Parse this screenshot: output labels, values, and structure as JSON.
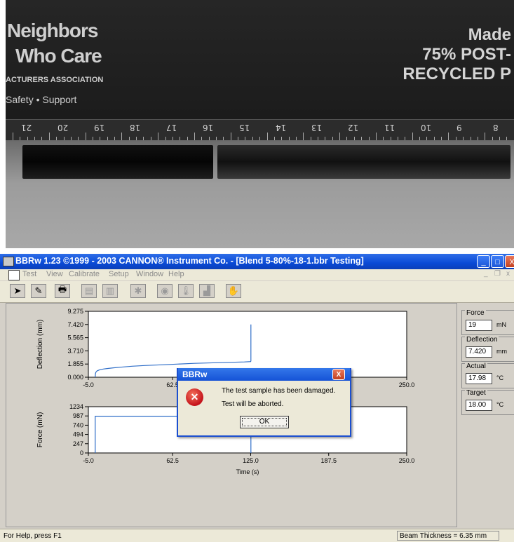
{
  "photo": {
    "brand_line1": "Neighbors",
    "brand_line2": "Who Care",
    "brand_line3": "ACTURERS ASSOCIATION",
    "brand_line4": "Safety • Support",
    "recycled_line1": "Made",
    "recycled_line2": "75% POST-",
    "recycled_line3": "RECYCLED P",
    "ruler_numbers": [
      "21",
      "20",
      "19",
      "18",
      "17",
      "16",
      "15",
      "14",
      "13",
      "12",
      "11",
      "10",
      "9",
      "8"
    ]
  },
  "window": {
    "title": "BBRw 1.23 ©1999 - 2003 CANNON® Instrument Co. - [Blend 5-80%-18-1.bbr    Testing]",
    "min": "_",
    "max": "□",
    "close": "X"
  },
  "menu": {
    "items": [
      "Test",
      "View",
      "Calibrate",
      "Setup",
      "Window",
      "Help"
    ],
    "mdi_min": "_",
    "mdi_restore": "❐",
    "mdi_close": "x"
  },
  "toolbar": {
    "buttons": [
      {
        "name": "run-icon",
        "glyph": "➤"
      },
      {
        "name": "open-icon",
        "glyph": "✎"
      },
      {
        "name": "print-icon",
        "glyph": "🖶"
      },
      {
        "name": "report-icon",
        "glyph": "▤"
      },
      {
        "name": "compare-icon",
        "glyph": "▥"
      },
      {
        "name": "calibrate-icon",
        "glyph": "✱"
      },
      {
        "name": "camera-icon",
        "glyph": "◉"
      },
      {
        "name": "thermometer-icon",
        "glyph": "🌡"
      },
      {
        "name": "beam-icon",
        "glyph": "▟"
      },
      {
        "name": "stop-hand-icon",
        "glyph": "✋"
      }
    ]
  },
  "chart_data": [
    {
      "type": "line",
      "title": "",
      "xlabel": "",
      "ylabel": "Deflection (mm)",
      "xlim": [
        -5.0,
        250.0
      ],
      "ylim": [
        0.0,
        9.275
      ],
      "yticks": [
        "9.275",
        "7.420",
        "5.565",
        "3.710",
        "1.855",
        "0.000"
      ],
      "xticks": [
        "-5.0",
        "62.5",
        "125.0",
        "187.5",
        "250.0"
      ],
      "series": [
        {
          "x": [
            0.5,
            0.7,
            1,
            2,
            4,
            7,
            10,
            15,
            20,
            30,
            40,
            60,
            80,
            100,
            120,
            125,
            125.2,
            125.2
          ],
          "y": [
            0.0,
            0.5,
            0.7,
            0.9,
            1.05,
            1.15,
            1.22,
            1.32,
            1.4,
            1.55,
            1.65,
            1.8,
            1.95,
            2.05,
            2.15,
            2.2,
            2.3,
            7.42
          ]
        }
      ]
    },
    {
      "type": "line",
      "title": "",
      "xlabel": "Time (s)",
      "ylabel": "Force (mN)",
      "xlim": [
        -5.0,
        250.0
      ],
      "ylim": [
        0,
        1234
      ],
      "yticks": [
        "1234",
        "987",
        "740",
        "494",
        "247",
        "0"
      ],
      "xticks": [
        "-5.0",
        "62.5",
        "125.0",
        "187.5",
        "250.0"
      ],
      "series": [
        {
          "x": [
            0.5,
            0.5,
            1,
            125,
            125.2,
            125.2
          ],
          "y": [
            0,
            980,
            980,
            980,
            980,
            0
          ]
        }
      ]
    }
  ],
  "side_panel": {
    "force": {
      "label": "Force",
      "value": "19",
      "unit": "mN"
    },
    "deflection": {
      "label": "Deflection",
      "value": "7.420",
      "unit": "mm"
    },
    "actual": {
      "label": "Actual",
      "value": "17.98",
      "unit": "°C"
    },
    "target": {
      "label": "Target",
      "value": "18.00",
      "unit": "°C"
    }
  },
  "dialog": {
    "title": "BBRw",
    "close": "X",
    "message1": "The test sample has been damaged.",
    "message2": "Test will be aborted.",
    "ok": "OK",
    "icon": "✕"
  },
  "status": {
    "help": "For Help, press F1",
    "beam": "Beam Thickness = 6.35 mm"
  },
  "colors": {
    "titlebar": "#0a4ad6",
    "trace": "#2f6ec8",
    "error": "#c4121a"
  }
}
